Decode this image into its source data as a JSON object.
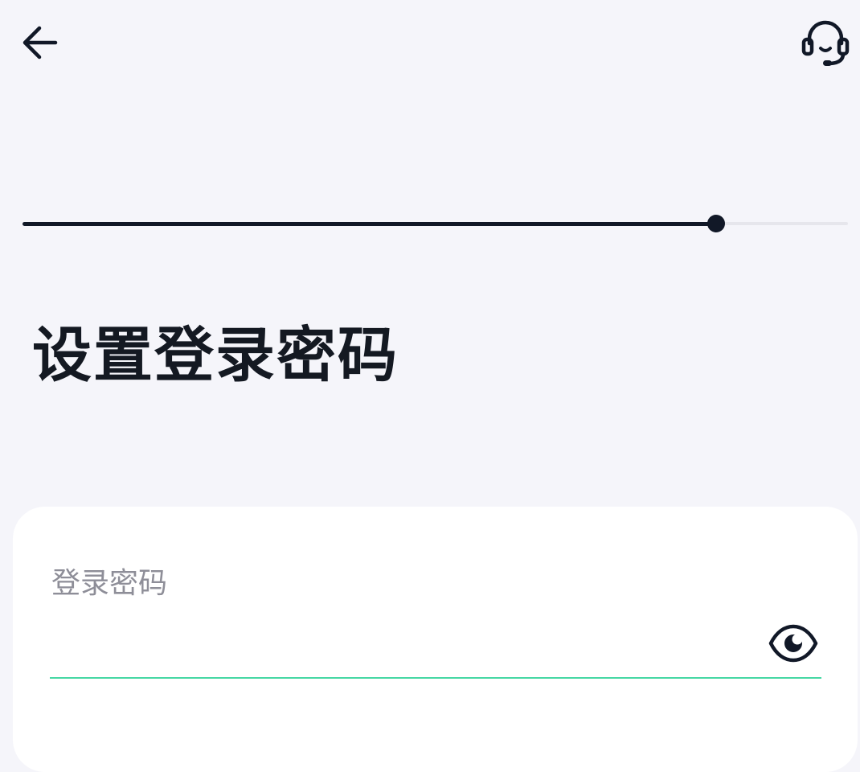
{
  "header": {
    "back_icon": "arrow-left-icon",
    "support_icon": "headset-icon"
  },
  "progress": {
    "value": 0.84
  },
  "page": {
    "title": "设置登录密码"
  },
  "form": {
    "password_label": "登录密码",
    "password_value": "",
    "visibility_icon": "eye-icon",
    "accent_color": "#46d7a4"
  },
  "colors": {
    "background": "#f5f5fa",
    "text": "#141922",
    "card": "#ffffff"
  }
}
